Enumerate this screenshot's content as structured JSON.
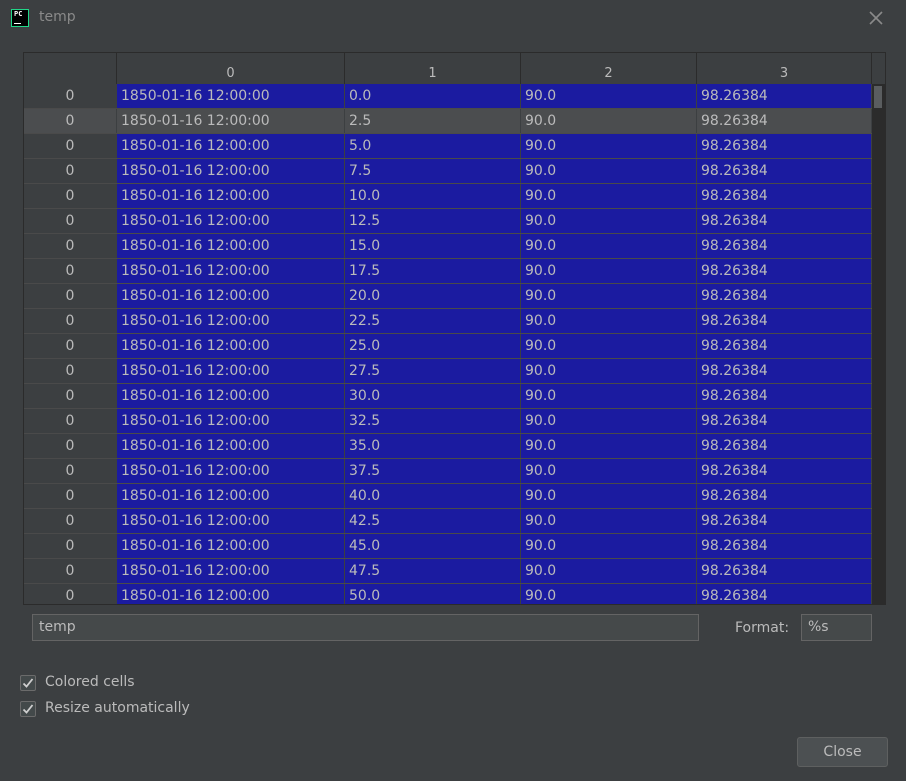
{
  "window": {
    "title": "temp",
    "app_icon_text": "PC"
  },
  "grid": {
    "columns": [
      "0",
      "1",
      "2",
      "3"
    ],
    "selected_row": 1,
    "rows": [
      {
        "index": "0",
        "c0": "1850-01-16 12:00:00",
        "c1": "0.0",
        "c2": "90.0",
        "c3": "98.26384"
      },
      {
        "index": "0",
        "c0": "1850-01-16 12:00:00",
        "c1": "2.5",
        "c2": "90.0",
        "c3": "98.26384"
      },
      {
        "index": "0",
        "c0": "1850-01-16 12:00:00",
        "c1": "5.0",
        "c2": "90.0",
        "c3": "98.26384"
      },
      {
        "index": "0",
        "c0": "1850-01-16 12:00:00",
        "c1": "7.5",
        "c2": "90.0",
        "c3": "98.26384"
      },
      {
        "index": "0",
        "c0": "1850-01-16 12:00:00",
        "c1": "10.0",
        "c2": "90.0",
        "c3": "98.26384"
      },
      {
        "index": "0",
        "c0": "1850-01-16 12:00:00",
        "c1": "12.5",
        "c2": "90.0",
        "c3": "98.26384"
      },
      {
        "index": "0",
        "c0": "1850-01-16 12:00:00",
        "c1": "15.0",
        "c2": "90.0",
        "c3": "98.26384"
      },
      {
        "index": "0",
        "c0": "1850-01-16 12:00:00",
        "c1": "17.5",
        "c2": "90.0",
        "c3": "98.26384"
      },
      {
        "index": "0",
        "c0": "1850-01-16 12:00:00",
        "c1": "20.0",
        "c2": "90.0",
        "c3": "98.26384"
      },
      {
        "index": "0",
        "c0": "1850-01-16 12:00:00",
        "c1": "22.5",
        "c2": "90.0",
        "c3": "98.26384"
      },
      {
        "index": "0",
        "c0": "1850-01-16 12:00:00",
        "c1": "25.0",
        "c2": "90.0",
        "c3": "98.26384"
      },
      {
        "index": "0",
        "c0": "1850-01-16 12:00:00",
        "c1": "27.5",
        "c2": "90.0",
        "c3": "98.26384"
      },
      {
        "index": "0",
        "c0": "1850-01-16 12:00:00",
        "c1": "30.0",
        "c2": "90.0",
        "c3": "98.26384"
      },
      {
        "index": "0",
        "c0": "1850-01-16 12:00:00",
        "c1": "32.5",
        "c2": "90.0",
        "c3": "98.26384"
      },
      {
        "index": "0",
        "c0": "1850-01-16 12:00:00",
        "c1": "35.0",
        "c2": "90.0",
        "c3": "98.26384"
      },
      {
        "index": "0",
        "c0": "1850-01-16 12:00:00",
        "c1": "37.5",
        "c2": "90.0",
        "c3": "98.26384"
      },
      {
        "index": "0",
        "c0": "1850-01-16 12:00:00",
        "c1": "40.0",
        "c2": "90.0",
        "c3": "98.26384"
      },
      {
        "index": "0",
        "c0": "1850-01-16 12:00:00",
        "c1": "42.5",
        "c2": "90.0",
        "c3": "98.26384"
      },
      {
        "index": "0",
        "c0": "1850-01-16 12:00:00",
        "c1": "45.0",
        "c2": "90.0",
        "c3": "98.26384"
      },
      {
        "index": "0",
        "c0": "1850-01-16 12:00:00",
        "c1": "47.5",
        "c2": "90.0",
        "c3": "98.26384"
      },
      {
        "index": "0",
        "c0": "1850-01-16 12:00:00",
        "c1": "50.0",
        "c2": "90.0",
        "c3": "98.26384"
      }
    ]
  },
  "footer": {
    "expression_value": "temp",
    "format_label": "Format:",
    "format_value": "%s",
    "colored_cells_label": "Colored cells",
    "colored_cells_checked": true,
    "resize_auto_label": "Resize automatically",
    "resize_auto_checked": true,
    "close_label": "Close"
  },
  "colors": {
    "background": "#3c3f41",
    "cell_fill": "#1b1ba0",
    "selected_row": "#4b4d4f",
    "text": "#bbbbbb"
  },
  "icons": {
    "app": "pycharm-icon",
    "close": "close-icon",
    "check": "checkmark-icon"
  }
}
